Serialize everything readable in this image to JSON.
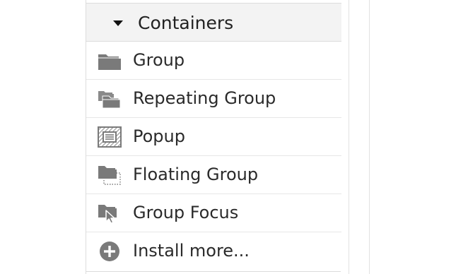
{
  "section": {
    "title": "Containers"
  },
  "items": [
    {
      "label": "Group",
      "icon": "folder-icon"
    },
    {
      "label": "Repeating Group",
      "icon": "stacked-folders-icon"
    },
    {
      "label": "Popup",
      "icon": "popup-icon"
    },
    {
      "label": "Floating Group",
      "icon": "floating-folder-icon"
    },
    {
      "label": "Group Focus",
      "icon": "folder-cursor-icon"
    },
    {
      "label": "Install more...",
      "icon": "plus-circle-icon"
    }
  ],
  "colors": {
    "icon": "#7a7a7a",
    "header_bg": "#f3f3f3",
    "text": "#2a2a2a"
  }
}
